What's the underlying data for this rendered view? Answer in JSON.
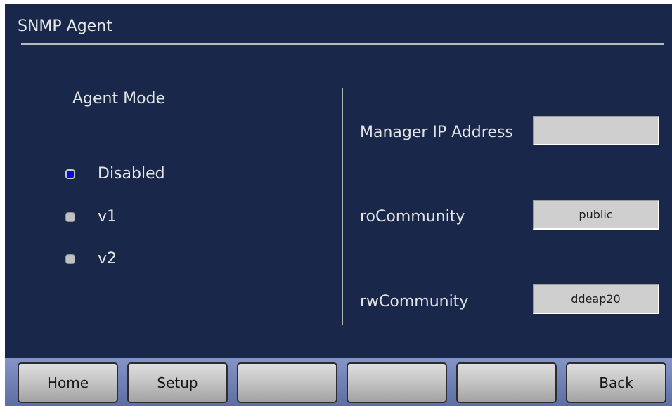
{
  "header": {
    "title": "SNMP Agent"
  },
  "agent_mode": {
    "label": "Agent Mode",
    "options": [
      {
        "label": "Disabled",
        "selected": true
      },
      {
        "label": "v1",
        "selected": false
      },
      {
        "label": "v2",
        "selected": false
      }
    ]
  },
  "fields": {
    "manager_ip": {
      "label": "Manager IP Address",
      "value": ""
    },
    "ro_community": {
      "label": "roCommunity",
      "value": "public"
    },
    "rw_community": {
      "label": "rwCommunity",
      "value": "ddeap20"
    }
  },
  "buttons": {
    "home": "Home",
    "setup": "Setup",
    "blank_1": "",
    "blank_2": "",
    "blank_3": "",
    "back": "Back"
  },
  "colors": {
    "panel_background": "#19284a",
    "selected_radio": "#0a0adf",
    "unselected_radio": "#c1c1c1",
    "button_bar": "#7383b8"
  }
}
